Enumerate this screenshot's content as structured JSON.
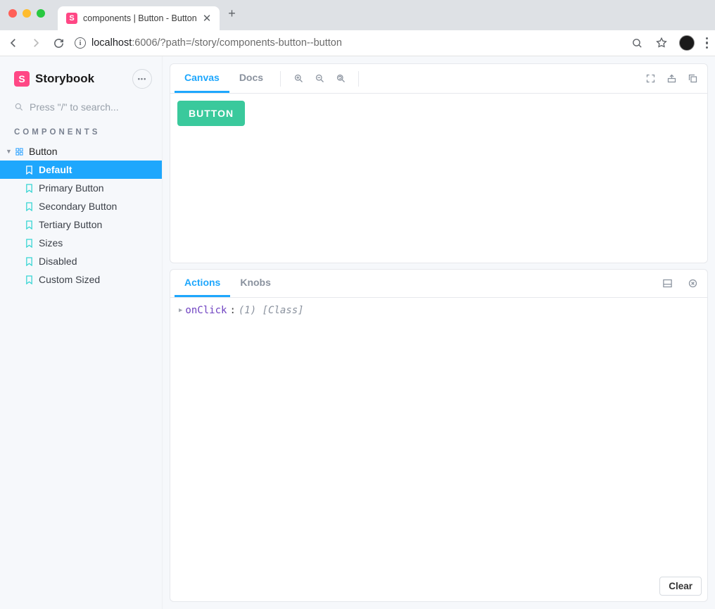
{
  "browser": {
    "tab_title": "components | Button - Button",
    "url_host": "localhost",
    "url_port": ":6006",
    "url_path": "/?path=/story/components-button--button"
  },
  "sidebar": {
    "brand": "Storybook",
    "search_placeholder": "Press \"/\" to search...",
    "section_label": "COMPONENTS",
    "component_name": "Button",
    "stories": [
      {
        "label": "Default",
        "selected": true
      },
      {
        "label": "Primary Button",
        "selected": false
      },
      {
        "label": "Secondary Button",
        "selected": false
      },
      {
        "label": "Tertiary Button",
        "selected": false
      },
      {
        "label": "Sizes",
        "selected": false
      },
      {
        "label": "Disabled",
        "selected": false
      },
      {
        "label": "Custom Sized",
        "selected": false
      }
    ]
  },
  "toolbar": {
    "canvas_label": "Canvas",
    "docs_label": "Docs"
  },
  "preview": {
    "button_label": "BUTTON"
  },
  "addons": {
    "actions_label": "Actions",
    "knobs_label": "Knobs",
    "log_key": "onClick",
    "log_sep": ": ",
    "log_value": "(1) [Class]",
    "clear_label": "Clear"
  }
}
